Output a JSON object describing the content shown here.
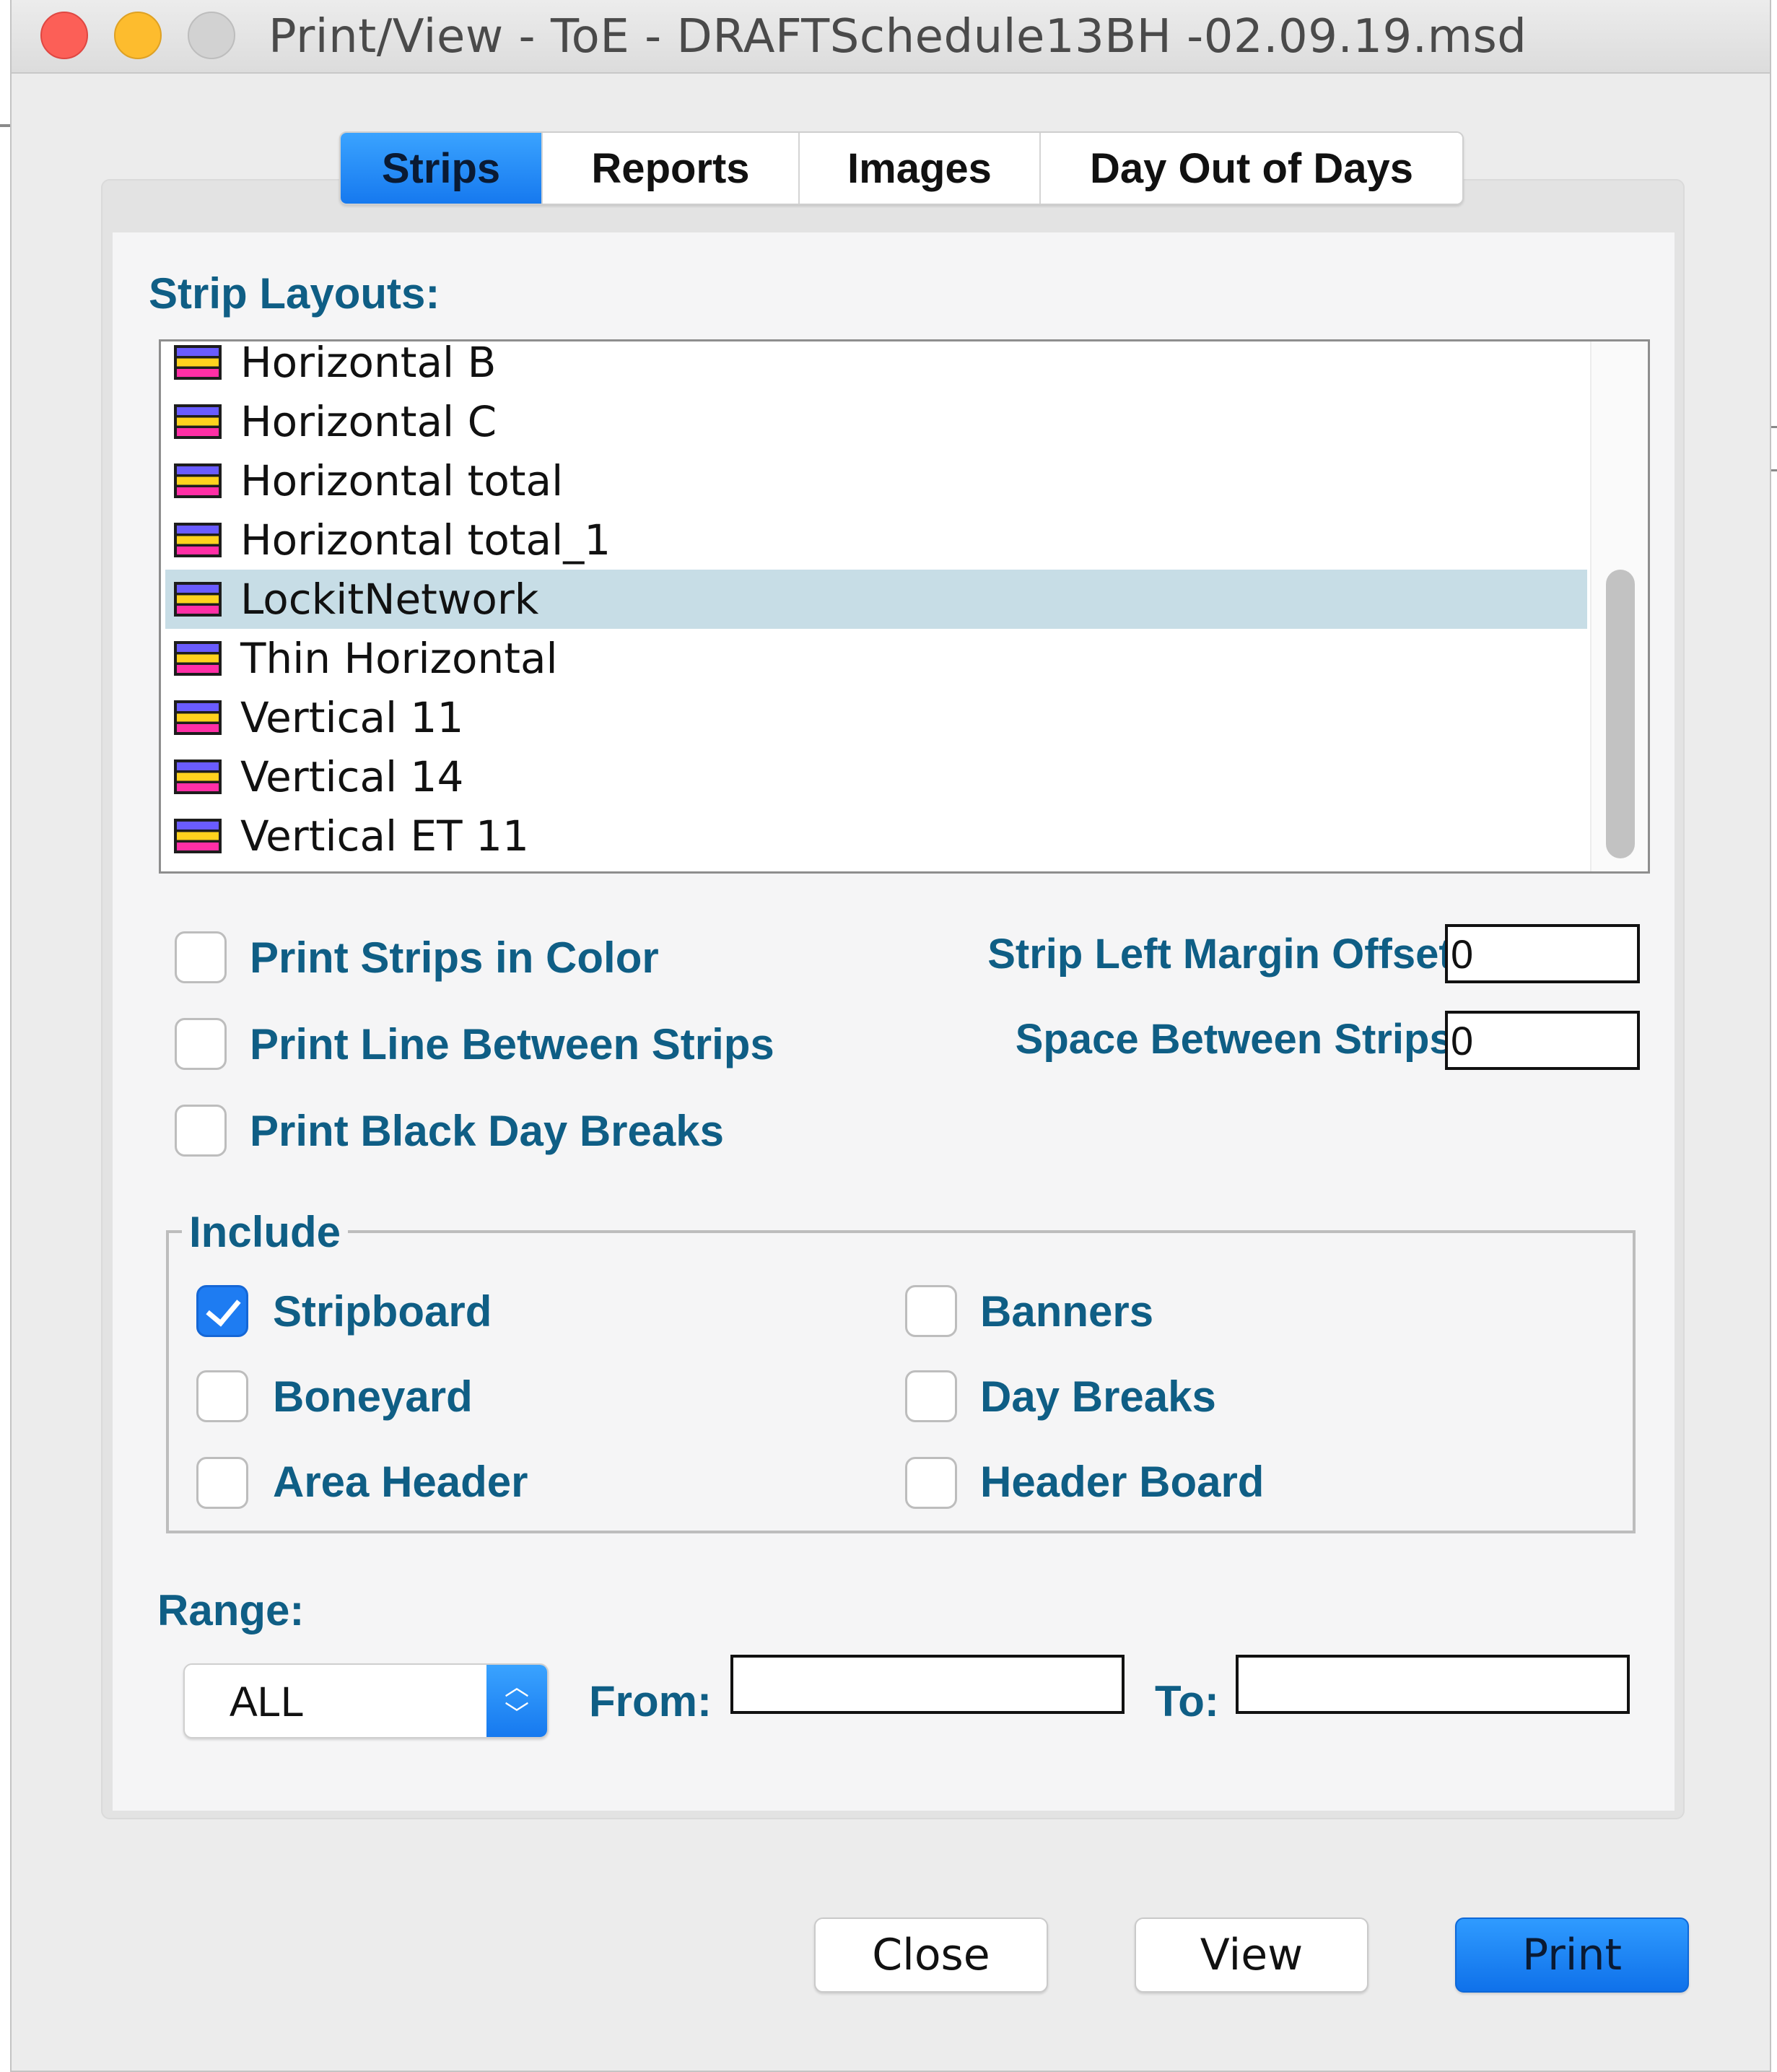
{
  "window": {
    "title": "Print/View - ToE - DRAFTSchedule13BH -02.09.19.msd"
  },
  "tabs": [
    {
      "label": "Strips",
      "active": true
    },
    {
      "label": "Reports",
      "active": false
    },
    {
      "label": "Images",
      "active": false
    },
    {
      "label": "Day Out of Days",
      "active": false
    }
  ],
  "strip_layouts": {
    "label": "Strip Layouts:",
    "items": [
      {
        "label": "Horizontal B",
        "selected": false
      },
      {
        "label": "Horizontal C",
        "selected": false
      },
      {
        "label": "Horizontal total",
        "selected": false
      },
      {
        "label": "Horizontal total_1",
        "selected": false
      },
      {
        "label": "LockitNetwork",
        "selected": true
      },
      {
        "label": "Thin Horizontal",
        "selected": false
      },
      {
        "label": "Vertical 11",
        "selected": false
      },
      {
        "label": "Vertical 14",
        "selected": false
      },
      {
        "label": "Vertical ET 11",
        "selected": false
      }
    ],
    "icon": "strip-layout-icon"
  },
  "print_options": [
    {
      "label": "Print Strips in Color",
      "checked": false
    },
    {
      "label": "Print Line Between Strips",
      "checked": false
    },
    {
      "label": "Print Black Day Breaks",
      "checked": false
    }
  ],
  "margin_offset": {
    "label": "Strip Left Margin Offset:",
    "value": "0"
  },
  "space_between": {
    "label": "Space Between Strips:",
    "value": "0"
  },
  "include": {
    "title": "Include",
    "items": [
      {
        "label": "Stripboard",
        "checked": true
      },
      {
        "label": "Boneyard",
        "checked": false
      },
      {
        "label": "Area Header",
        "checked": false
      },
      {
        "label": "Banners",
        "checked": false
      },
      {
        "label": "Day Breaks",
        "checked": false
      },
      {
        "label": "Header Board",
        "checked": false
      }
    ]
  },
  "range": {
    "label": "Range:",
    "selected": "ALL",
    "from_label": "From:",
    "from_value": "",
    "to_label": "To:",
    "to_value": ""
  },
  "buttons": {
    "close": "Close",
    "view": "View",
    "print": "Print"
  },
  "colors": {
    "accent": "#1679ef",
    "label_blue": "#0f5e85",
    "selection": "#c7dde6"
  }
}
